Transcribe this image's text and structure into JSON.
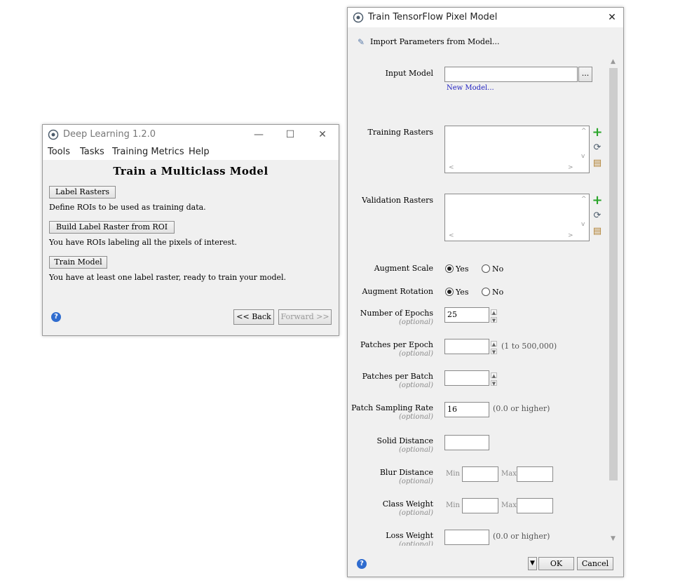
{
  "deep_learning_window": {
    "title": "Deep Learning 1.2.0",
    "menu": [
      "Tools",
      "Tasks",
      "Training Metrics",
      "Help"
    ],
    "heading": "Train a Multiclass Model",
    "steps": [
      {
        "button": "Label Rasters",
        "description": "Define ROIs to be used as training data."
      },
      {
        "button": "Build Label Raster from ROI",
        "description": "You have ROIs labeling all the pixels of interest."
      },
      {
        "button": "Train Model",
        "description": "You have at least one label raster, ready to train your model."
      }
    ],
    "back_label": "<< Back",
    "forward_label": "Forward >>"
  },
  "train_window": {
    "title": "Train TensorFlow Pixel Model",
    "import_label": "Import Parameters from Model...",
    "input_model": {
      "label": "Input Model",
      "value": "",
      "browse": "...",
      "new_model_link": "New Model..."
    },
    "training_rasters_label": "Training Rasters",
    "validation_rasters_label": "Validation Rasters",
    "augment_scale": {
      "label": "Augment Scale",
      "yes": "Yes",
      "no": "No",
      "selected": "Yes"
    },
    "augment_rotation": {
      "label": "Augment Rotation",
      "yes": "Yes",
      "no": "No",
      "selected": "Yes"
    },
    "optional_text": "(optional)",
    "number_of_epochs": {
      "label": "Number of Epochs",
      "value": "25"
    },
    "patches_per_epoch": {
      "label": "Patches per Epoch",
      "value": "",
      "hint": "(1 to 500,000)"
    },
    "patches_per_batch": {
      "label": "Patches per Batch",
      "value": ""
    },
    "patch_sampling_rate": {
      "label": "Patch Sampling Rate",
      "value": "16",
      "hint": "(0.0 or higher)"
    },
    "solid_distance": {
      "label": "Solid Distance",
      "value": ""
    },
    "blur_distance": {
      "label": "Blur Distance",
      "min_label": "Min",
      "max_label": "Max",
      "min": "",
      "max": ""
    },
    "class_weight": {
      "label": "Class Weight",
      "min_label": "Min",
      "max_label": "Max",
      "min": "",
      "max": ""
    },
    "loss_weight": {
      "label": "Loss Weight",
      "value": "",
      "hint": "(0.0 or higher)"
    },
    "ok_label": "OK",
    "cancel_label": "Cancel"
  },
  "colors": {
    "accent_green": "#2aa52a",
    "link_blue": "#1f1fbf",
    "help_blue": "#2f6ccf"
  }
}
